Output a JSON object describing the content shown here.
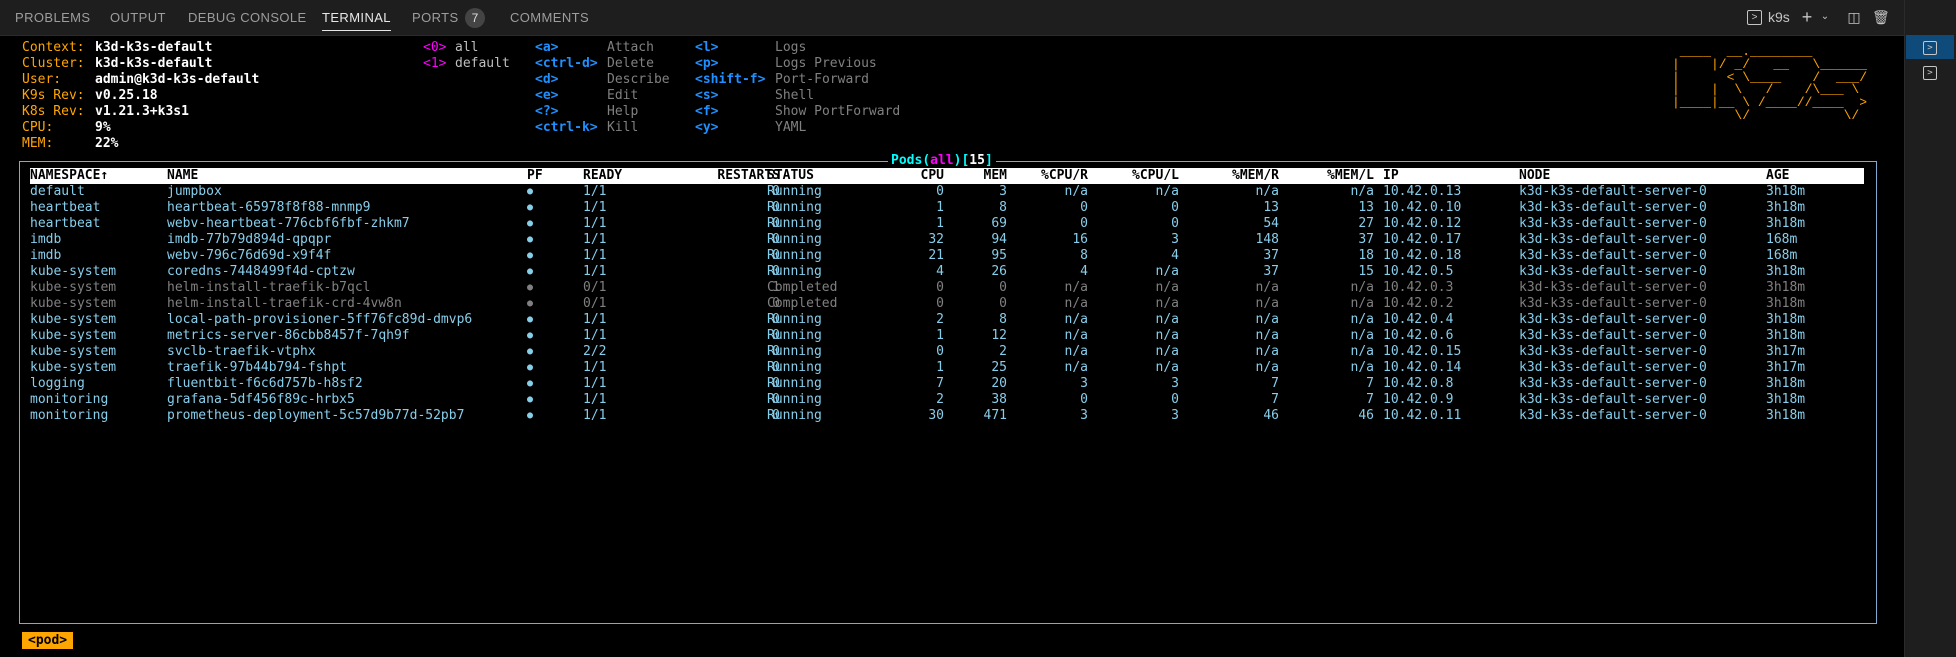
{
  "panel": {
    "tabs": [
      {
        "label": "PROBLEMS"
      },
      {
        "label": "OUTPUT"
      },
      {
        "label": "DEBUG CONSOLE"
      },
      {
        "label": "TERMINAL"
      },
      {
        "label": "PORTS"
      },
      {
        "label": "COMMENTS"
      }
    ],
    "ports_count": "7",
    "terminal_name": "k9s"
  },
  "k9s": {
    "info": [
      {
        "key": "Context:",
        "value": "k3d-k3s-default"
      },
      {
        "key": "Cluster:",
        "value": "k3d-k3s-default"
      },
      {
        "key": "User:",
        "value": "admin@k3d-k3s-default"
      },
      {
        "key": "K9s Rev:",
        "value": "v0.25.18"
      },
      {
        "key": "K8s Rev:",
        "value": "v1.21.3+k3s1"
      },
      {
        "key": "CPU:",
        "value": "9%"
      },
      {
        "key": "MEM:",
        "value": "22%"
      }
    ],
    "namespaces": [
      {
        "key": "<0>",
        "label": "all"
      },
      {
        "key": "<1>",
        "label": "default"
      }
    ],
    "hotkeys_col1": [
      {
        "key": "<a>",
        "label": "Attach"
      },
      {
        "key": "<ctrl-d>",
        "label": "Delete"
      },
      {
        "key": "<d>",
        "label": "Describe"
      },
      {
        "key": "<e>",
        "label": "Edit"
      },
      {
        "key": "<?>",
        "label": "Help"
      },
      {
        "key": "<ctrl-k>",
        "label": "Kill"
      }
    ],
    "hotkeys_col2": [
      {
        "key": "<l>",
        "label": "Logs"
      },
      {
        "key": "<p>",
        "label": "Logs Previous"
      },
      {
        "key": "<shift-f>",
        "label": "Port-Forward"
      },
      {
        "key": "<s>",
        "label": "Shell"
      },
      {
        "key": "<f>",
        "label": "Show PortForward"
      },
      {
        "key": "<y>",
        "label": "YAML"
      }
    ],
    "logo_lines": [
      " ____  __.________       ",
      "|    |/ _/   __   \\______",
      "|      < \\____    /  ___/",
      "|    |  \\   /    /\\___ \\ ",
      "|____|__ \\ /____//____  >",
      "        \\/            \\/ "
    ],
    "table_title": {
      "resource": "Pods",
      "namespace": "all",
      "count": "15"
    },
    "columns": [
      "NAMESPACE↑",
      "NAME",
      "PF",
      "READY",
      "RESTARTS",
      "STATUS",
      "CPU",
      "MEM",
      "%CPU/R",
      "%CPU/L",
      "%MEM/R",
      "%MEM/L",
      "IP",
      "NODE",
      "AGE"
    ],
    "rows": [
      [
        "default",
        "jumpbox",
        "●",
        "1/1",
        "0",
        "Running",
        "0",
        "3",
        "n/a",
        "n/a",
        "n/a",
        "n/a",
        "10.42.0.13",
        "k3d-k3s-default-server-0",
        "3h18m"
      ],
      [
        "heartbeat",
        "heartbeat-65978f8f88-mnmp9",
        "●",
        "1/1",
        "0",
        "Running",
        "1",
        "8",
        "0",
        "0",
        "13",
        "13",
        "10.42.0.10",
        "k3d-k3s-default-server-0",
        "3h18m"
      ],
      [
        "heartbeat",
        "webv-heartbeat-776cbf6fbf-zhkm7",
        "●",
        "1/1",
        "0",
        "Running",
        "1",
        "69",
        "0",
        "0",
        "54",
        "27",
        "10.42.0.12",
        "k3d-k3s-default-server-0",
        "3h18m"
      ],
      [
        "imdb",
        "imdb-77b79d894d-qpqpr",
        "●",
        "1/1",
        "0",
        "Running",
        "32",
        "94",
        "16",
        "3",
        "148",
        "37",
        "10.42.0.17",
        "k3d-k3s-default-server-0",
        "168m"
      ],
      [
        "imdb",
        "webv-796c76d69d-x9f4f",
        "●",
        "1/1",
        "0",
        "Running",
        "21",
        "95",
        "8",
        "4",
        "37",
        "18",
        "10.42.0.18",
        "k3d-k3s-default-server-0",
        "168m"
      ],
      [
        "kube-system",
        "coredns-7448499f4d-cptzw",
        "●",
        "1/1",
        "0",
        "Running",
        "4",
        "26",
        "4",
        "n/a",
        "37",
        "15",
        "10.42.0.5",
        "k3d-k3s-default-server-0",
        "3h18m"
      ],
      [
        "kube-system",
        "helm-install-traefik-b7qcl",
        "●",
        "0/1",
        "1",
        "Completed",
        "0",
        "0",
        "n/a",
        "n/a",
        "n/a",
        "n/a",
        "10.42.0.3",
        "k3d-k3s-default-server-0",
        "3h18m"
      ],
      [
        "kube-system",
        "helm-install-traefik-crd-4vw8n",
        "●",
        "0/1",
        "0",
        "Completed",
        "0",
        "0",
        "n/a",
        "n/a",
        "n/a",
        "n/a",
        "10.42.0.2",
        "k3d-k3s-default-server-0",
        "3h18m"
      ],
      [
        "kube-system",
        "local-path-provisioner-5ff76fc89d-dmvp6",
        "●",
        "1/1",
        "0",
        "Running",
        "2",
        "8",
        "n/a",
        "n/a",
        "n/a",
        "n/a",
        "10.42.0.4",
        "k3d-k3s-default-server-0",
        "3h18m"
      ],
      [
        "kube-system",
        "metrics-server-86cbb8457f-7qh9f",
        "●",
        "1/1",
        "0",
        "Running",
        "1",
        "12",
        "n/a",
        "n/a",
        "n/a",
        "n/a",
        "10.42.0.6",
        "k3d-k3s-default-server-0",
        "3h18m"
      ],
      [
        "kube-system",
        "svclb-traefik-vtphx",
        "●",
        "2/2",
        "0",
        "Running",
        "0",
        "2",
        "n/a",
        "n/a",
        "n/a",
        "n/a",
        "10.42.0.15",
        "k3d-k3s-default-server-0",
        "3h17m"
      ],
      [
        "kube-system",
        "traefik-97b44b794-fshpt",
        "●",
        "1/1",
        "0",
        "Running",
        "1",
        "25",
        "n/a",
        "n/a",
        "n/a",
        "n/a",
        "10.42.0.14",
        "k3d-k3s-default-server-0",
        "3h17m"
      ],
      [
        "logging",
        "fluentbit-f6c6d757b-h8sf2",
        "●",
        "1/1",
        "0",
        "Running",
        "7",
        "20",
        "3",
        "3",
        "7",
        "7",
        "10.42.0.8",
        "k3d-k3s-default-server-0",
        "3h18m"
      ],
      [
        "monitoring",
        "grafana-5df456f89c-hrbx5",
        "●",
        "1/1",
        "0",
        "Running",
        "2",
        "38",
        "0",
        "0",
        "7",
        "7",
        "10.42.0.9",
        "k3d-k3s-default-server-0",
        "3h18m"
      ],
      [
        "monitoring",
        "prometheus-deployment-5c57d9b77d-52pb7",
        "●",
        "1/1",
        "0",
        "Running",
        "30",
        "471",
        "3",
        "3",
        "46",
        "46",
        "10.42.0.11",
        "k3d-k3s-default-server-0",
        "3h18m"
      ]
    ],
    "crumb": "<pod>"
  },
  "colors": {
    "info_key": "#ffa500",
    "namespace_key": "#ff00ff",
    "hotkey": "#1e90ff",
    "row_running": "#87ceeb",
    "row_completed": "#808080",
    "frame_border": "#7fa9d0",
    "title": "#00ffff"
  }
}
